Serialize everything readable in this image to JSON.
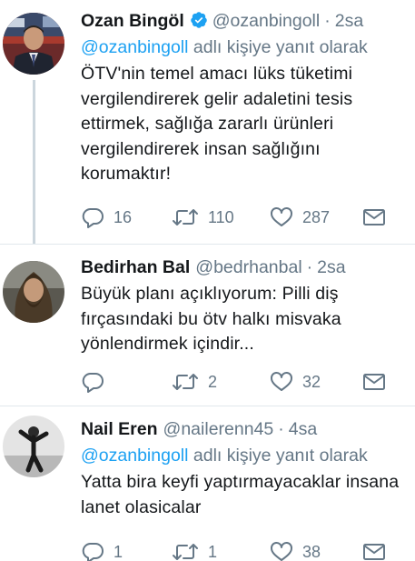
{
  "tweets": [
    {
      "name": "Ozan Bingöl",
      "verified": true,
      "handle": "@ozanbingoll",
      "dot": "·",
      "time": "2sa",
      "reply_to": {
        "mention": "@ozanbingoll",
        "suffix": "adlı kişiye yanıt olarak"
      },
      "text_lines": [
        "ÖTV'nin temel amacı lüks tüketimi",
        "vergilendirerek gelir adaletini tesis",
        "ettirmek,  sağlığa zararlı ürünleri",
        "vergilendirerek insan sağlığını",
        "korumaktır!"
      ],
      "replies": "16",
      "retweets": "110",
      "likes": "287"
    },
    {
      "name": "Bedirhan Bal",
      "verified": false,
      "handle": "@bedrhanbal",
      "dot": "·",
      "time": "2sa",
      "text_lines": [
        "Büyük planı açıklıyorum: Pilli diş",
        "fırçasındaki bu ötv halkı misvaka",
        "yönlendirmek içindir..."
      ],
      "replies": "",
      "retweets": "2",
      "likes": "32"
    },
    {
      "name": "Nail Eren",
      "verified": false,
      "handle": "@nailerenn45",
      "dot": "·",
      "time": "4sa",
      "reply_to": {
        "mention": "@ozanbingoll",
        "suffix": "adlı kişiye yanıt olarak"
      },
      "text_lines": [
        "Yatta bira keyfi yaptırmayacaklar insana",
        "lanet olasicalar"
      ],
      "replies": "1",
      "retweets": "1",
      "likes": "38"
    }
  ],
  "icons": {
    "reply": "reply-icon",
    "retweet": "retweet-icon",
    "like": "heart-icon",
    "dm": "envelope-icon",
    "verified": "verified-badge-icon"
  },
  "colors": {
    "text": "#14171a",
    "secondary": "#657786",
    "link": "#1da1f2",
    "divider": "#e1e8ed",
    "thread_line": "#ccd6dd"
  }
}
